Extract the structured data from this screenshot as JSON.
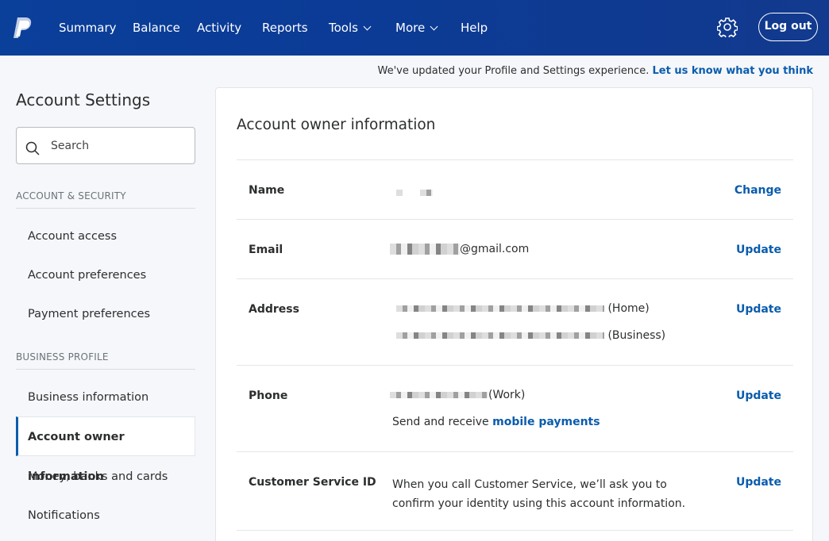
{
  "nav": {
    "items": [
      {
        "label": "Summary"
      },
      {
        "label": "Balance"
      },
      {
        "label": "Activity"
      },
      {
        "label": "Reports"
      },
      {
        "label": "Tools"
      },
      {
        "label": "More"
      },
      {
        "label": "Help"
      }
    ],
    "logout_label": "Log out",
    "icons": {
      "logo": "paypal-logo-icon",
      "settings": "gear-icon",
      "dropdown": "chevron-down-icon"
    }
  },
  "notice": {
    "text": "We've updated your Profile and Settings experience.",
    "link": "Let us know what you think"
  },
  "sidebar": {
    "title": "Account Settings",
    "search_placeholder": "Search",
    "sections": [
      {
        "heading": "ACCOUNT & SECURITY",
        "items": [
          "Account access",
          "Account preferences",
          "Payment preferences"
        ]
      },
      {
        "heading": "BUSINESS PROFILE",
        "items": [
          "Business information",
          "Account owner information",
          "Money, banks and cards",
          "Notifications"
        ]
      }
    ],
    "active_item": "Account owner information"
  },
  "main": {
    "title": "Account owner information",
    "rows": {
      "name": {
        "label": "Name",
        "action": "Change"
      },
      "email": {
        "label": "Email",
        "value_suffix": "@gmail.com",
        "action": "Update"
      },
      "address": {
        "label": "Address",
        "home_tag": "(Home)",
        "business_tag": "(Business)",
        "action": "Update"
      },
      "phone": {
        "label": "Phone",
        "tag": "(Work)",
        "note": "Send and receive",
        "note_link": "mobile payments",
        "action": "Update"
      },
      "csid": {
        "label": "Customer Service ID",
        "text_line1": "When you call Customer Service, we’ll ask you to",
        "text_line2": "confirm your identity using this account information.",
        "action": "Update"
      }
    }
  },
  "colors": {
    "nav_bg": "#0b3b96",
    "link": "#0a5cad",
    "page_bg": "#f5f7fa"
  }
}
